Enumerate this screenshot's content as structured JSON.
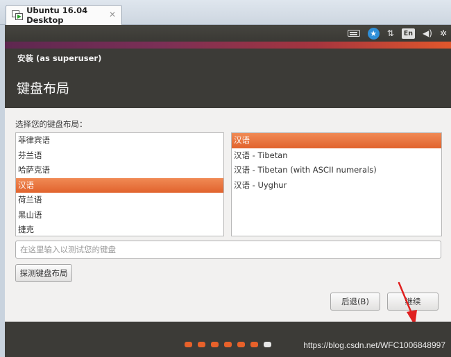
{
  "host": {
    "tab_title": "Ubuntu 16.04 Desktop",
    "close_glyph": "✕"
  },
  "panel": {
    "tray": {
      "keyboard_icon": "keyboard-icon",
      "accessibility_glyph": "★",
      "network_glyph": "⇅",
      "input_method": "En",
      "volume_glyph": "◀)",
      "settings_glyph": "✲"
    }
  },
  "installer": {
    "window_title": "安装 (as superuser)",
    "page_heading": "键盘布局",
    "prompt": "选择您的键盘布局：",
    "layouts": [
      {
        "label": "菲律宾语",
        "selected": false
      },
      {
        "label": "芬兰语",
        "selected": false
      },
      {
        "label": "哈萨克语",
        "selected": false
      },
      {
        "label": "汉语",
        "selected": true
      },
      {
        "label": "荷兰语",
        "selected": false
      },
      {
        "label": "黑山语",
        "selected": false
      },
      {
        "label": "捷克",
        "selected": false
      }
    ],
    "variants": [
      {
        "label": "汉语",
        "selected": true
      },
      {
        "label": "汉语 - Tibetan",
        "selected": false
      },
      {
        "label": "汉语 - Tibetan (with ASCII numerals)",
        "selected": false
      },
      {
        "label": "汉语 - Uyghur",
        "selected": false
      }
    ],
    "test_placeholder": "在这里输入以测试您的键盘",
    "detect_button": "探测键盘布局",
    "back_button": "后退(B)",
    "continue_button": "继续"
  },
  "progress": {
    "total_steps": 7,
    "current_step": 7
  },
  "watermark": "https://blog.csdn.net/WFC1006848997",
  "colors": {
    "accent": "#e1632d",
    "panel": "#3c3b37",
    "annotation_arrow": "#e02020"
  }
}
